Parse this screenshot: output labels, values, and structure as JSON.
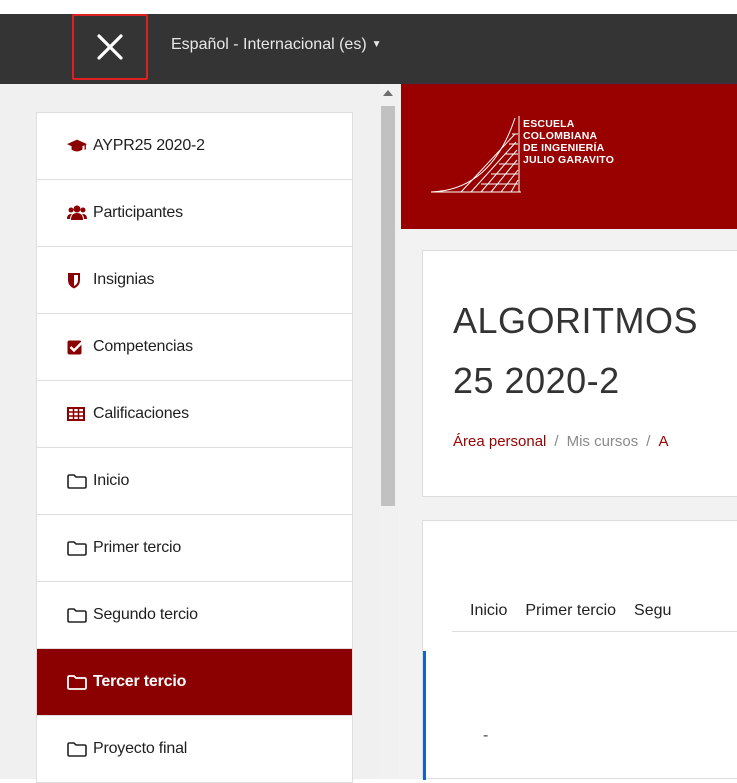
{
  "navbar": {
    "close_icon": "close-icon",
    "language_label": "Español - Internacional (es)",
    "caret_icon": "caret-down-icon"
  },
  "drawer": {
    "items": [
      {
        "label": "AYPR25 2020-2",
        "icon": "graduation-cap-icon"
      },
      {
        "label": "Participantes",
        "icon": "users-icon"
      },
      {
        "label": "Insignias",
        "icon": "shield-icon"
      },
      {
        "label": "Competencias",
        "icon": "check-square-icon"
      },
      {
        "label": "Calificaciones",
        "icon": "table-icon"
      },
      {
        "label": "Inicio",
        "icon": "folder-icon"
      },
      {
        "label": "Primer tercio",
        "icon": "folder-icon"
      },
      {
        "label": "Segundo tercio",
        "icon": "folder-icon"
      },
      {
        "label": "Tercer tercio",
        "icon": "folder-icon",
        "active": true
      },
      {
        "label": "Proyecto final",
        "icon": "folder-icon"
      }
    ]
  },
  "banner": {
    "logo_lines": [
      "ESCUELA",
      "COLOMBIANA",
      "DE INGENIERÍA",
      "JULIO GARAVITO"
    ]
  },
  "course": {
    "title": "ALGORITMOS\n25 2020-2",
    "breadcrumb": [
      "Área personal",
      "Mis cursos",
      "A"
    ]
  },
  "tabs": [
    "Inicio",
    "Primer tercio",
    "Segu"
  ],
  "content": {
    "dash": "-"
  },
  "colors": {
    "brand": "#990000",
    "active": "#8b0000",
    "navbar": "#343434",
    "accent": "#1565c0"
  }
}
